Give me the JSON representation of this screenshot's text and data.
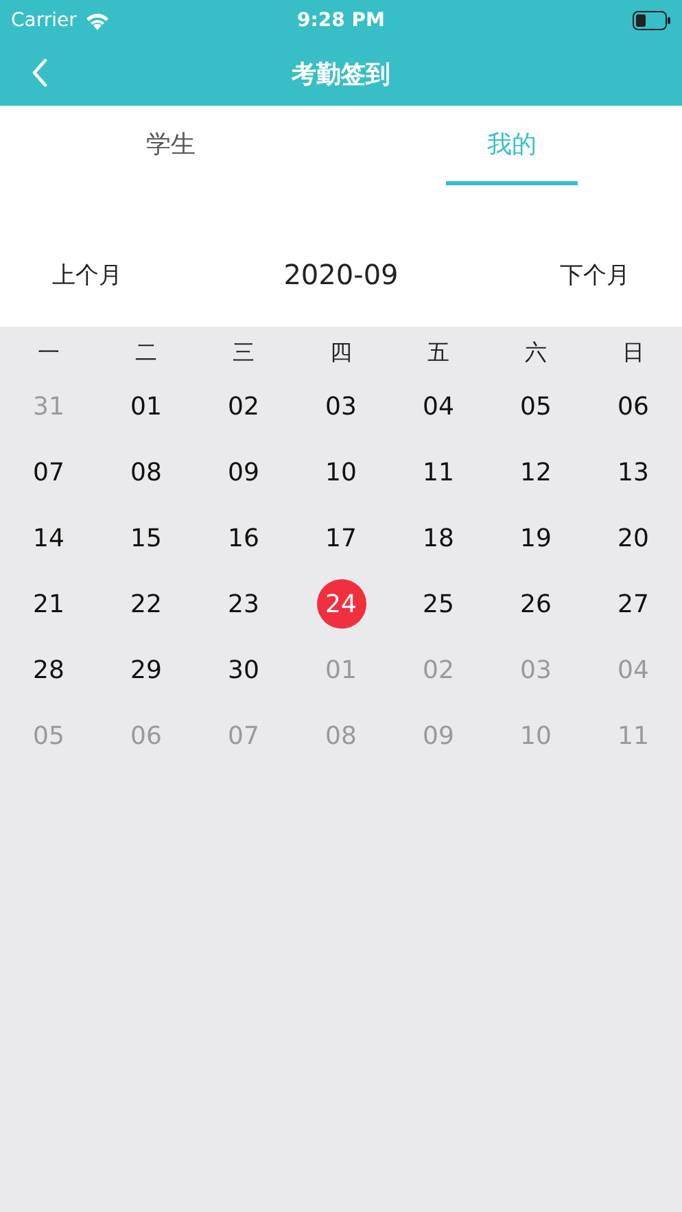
{
  "status_bar": {
    "carrier": "Carrier",
    "time": "9:28 PM"
  },
  "nav": {
    "title": "考勤签到"
  },
  "tabs": [
    {
      "label": "学生",
      "selected": false
    },
    {
      "label": "我的",
      "selected": true
    }
  ],
  "month_nav": {
    "prev": "上个月",
    "current": "2020-09",
    "next": "下个月"
  },
  "calendar": {
    "weekdays": [
      "一",
      "二",
      "三",
      "四",
      "五",
      "六",
      "日"
    ],
    "days": [
      {
        "label": "31",
        "in_month": false,
        "selected": false
      },
      {
        "label": "01",
        "in_month": true,
        "selected": false
      },
      {
        "label": "02",
        "in_month": true,
        "selected": false
      },
      {
        "label": "03",
        "in_month": true,
        "selected": false
      },
      {
        "label": "04",
        "in_month": true,
        "selected": false
      },
      {
        "label": "05",
        "in_month": true,
        "selected": false
      },
      {
        "label": "06",
        "in_month": true,
        "selected": false
      },
      {
        "label": "07",
        "in_month": true,
        "selected": false
      },
      {
        "label": "08",
        "in_month": true,
        "selected": false
      },
      {
        "label": "09",
        "in_month": true,
        "selected": false
      },
      {
        "label": "10",
        "in_month": true,
        "selected": false
      },
      {
        "label": "11",
        "in_month": true,
        "selected": false
      },
      {
        "label": "12",
        "in_month": true,
        "selected": false
      },
      {
        "label": "13",
        "in_month": true,
        "selected": false
      },
      {
        "label": "14",
        "in_month": true,
        "selected": false
      },
      {
        "label": "15",
        "in_month": true,
        "selected": false
      },
      {
        "label": "16",
        "in_month": true,
        "selected": false
      },
      {
        "label": "17",
        "in_month": true,
        "selected": false
      },
      {
        "label": "18",
        "in_month": true,
        "selected": false
      },
      {
        "label": "19",
        "in_month": true,
        "selected": false
      },
      {
        "label": "20",
        "in_month": true,
        "selected": false
      },
      {
        "label": "21",
        "in_month": true,
        "selected": false
      },
      {
        "label": "22",
        "in_month": true,
        "selected": false
      },
      {
        "label": "23",
        "in_month": true,
        "selected": false
      },
      {
        "label": "24",
        "in_month": true,
        "selected": true
      },
      {
        "label": "25",
        "in_month": true,
        "selected": false
      },
      {
        "label": "26",
        "in_month": true,
        "selected": false
      },
      {
        "label": "27",
        "in_month": true,
        "selected": false
      },
      {
        "label": "28",
        "in_month": true,
        "selected": false
      },
      {
        "label": "29",
        "in_month": true,
        "selected": false
      },
      {
        "label": "30",
        "in_month": true,
        "selected": false
      },
      {
        "label": "01",
        "in_month": false,
        "selected": false
      },
      {
        "label": "02",
        "in_month": false,
        "selected": false
      },
      {
        "label": "03",
        "in_month": false,
        "selected": false
      },
      {
        "label": "04",
        "in_month": false,
        "selected": false
      },
      {
        "label": "05",
        "in_month": false,
        "selected": false
      },
      {
        "label": "06",
        "in_month": false,
        "selected": false
      },
      {
        "label": "07",
        "in_month": false,
        "selected": false
      },
      {
        "label": "08",
        "in_month": false,
        "selected": false
      },
      {
        "label": "09",
        "in_month": false,
        "selected": false
      },
      {
        "label": "10",
        "in_month": false,
        "selected": false
      },
      {
        "label": "11",
        "in_month": false,
        "selected": false
      }
    ]
  }
}
